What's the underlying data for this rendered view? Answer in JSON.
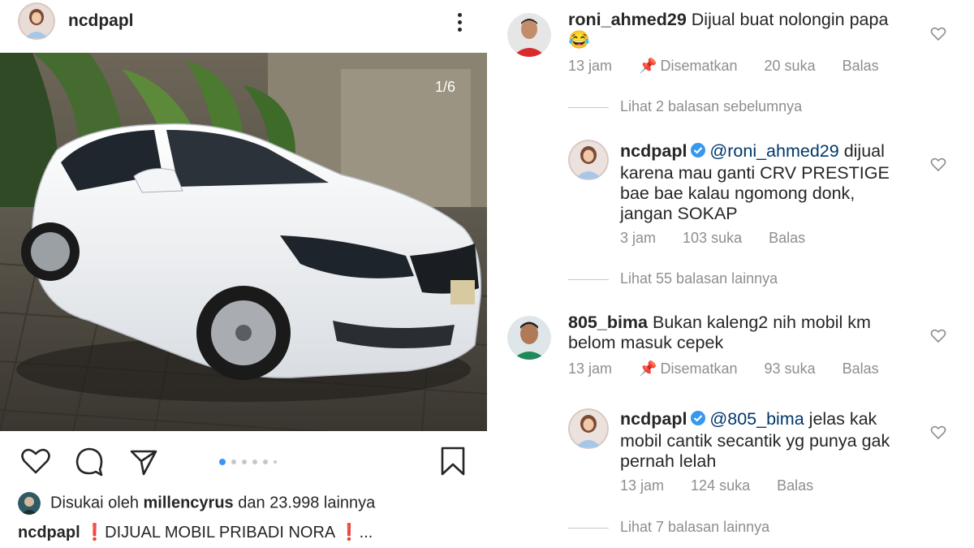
{
  "post": {
    "username": "ncdpapl",
    "counter": "1/6",
    "likes_prefix": "Disukai oleh ",
    "likes_user": "millencyrus",
    "likes_suffix": " dan 23.998 lainnya",
    "caption_user": "ncdpapl",
    "caption_text": "DIJUAL MOBIL PRIBADI NORA",
    "caption_more": "...",
    "carousel_index": 1,
    "carousel_total": 6
  },
  "icons": {
    "like": "heart-icon",
    "comment": "comment-icon",
    "share": "paper-plane-icon",
    "save": "bookmark-icon",
    "more": "more-vertical-icon",
    "pin": "pin-icon",
    "verified": "verified-badge-icon"
  },
  "colors": {
    "text": "#262626",
    "muted": "#8e8e8e",
    "mention": "#00376b",
    "verified": "#3897f0",
    "alert": "#e02020"
  },
  "comments": [
    {
      "user": "roni_ahmed29",
      "text": "Dijual buat nolongin papa",
      "emoji": "😂",
      "time": "13 jam",
      "pinned": "Disematkan",
      "likes": "20 suka",
      "reply": "Balas"
    },
    {
      "view_replies": "Lihat 2 balasan sebelumnya"
    },
    {
      "user": "ncdpapl",
      "mention": "@roni_ahmed29",
      "text_line1": " dijual",
      "text_line2": "karena mau ganti CRV PRESTIGE",
      "text_line3": "bae bae kalau ngomong donk,",
      "text_line4": "jangan SOKAP",
      "time": "3 jam",
      "likes": "103 suka",
      "reply": "Balas"
    },
    {
      "view_replies": "Lihat 55 balasan lainnya"
    },
    {
      "user": "805_bima",
      "text_line1": "Bukan kaleng2 nih mobil km",
      "text_line2": "belom masuk cepek",
      "time": "13 jam",
      "pinned": "Disematkan",
      "likes": "93 suka",
      "reply": "Balas"
    },
    {
      "user": "ncdpapl",
      "mention": "@805_bima",
      "text_line1": " jelas kak",
      "text_line2": "mobil cantik secantik yg punya gak",
      "text_line3": "pernah lelah",
      "time": "13 jam",
      "likes": "124 suka",
      "reply": "Balas"
    },
    {
      "view_replies": "Lihat 7 balasan lainnya"
    }
  ]
}
